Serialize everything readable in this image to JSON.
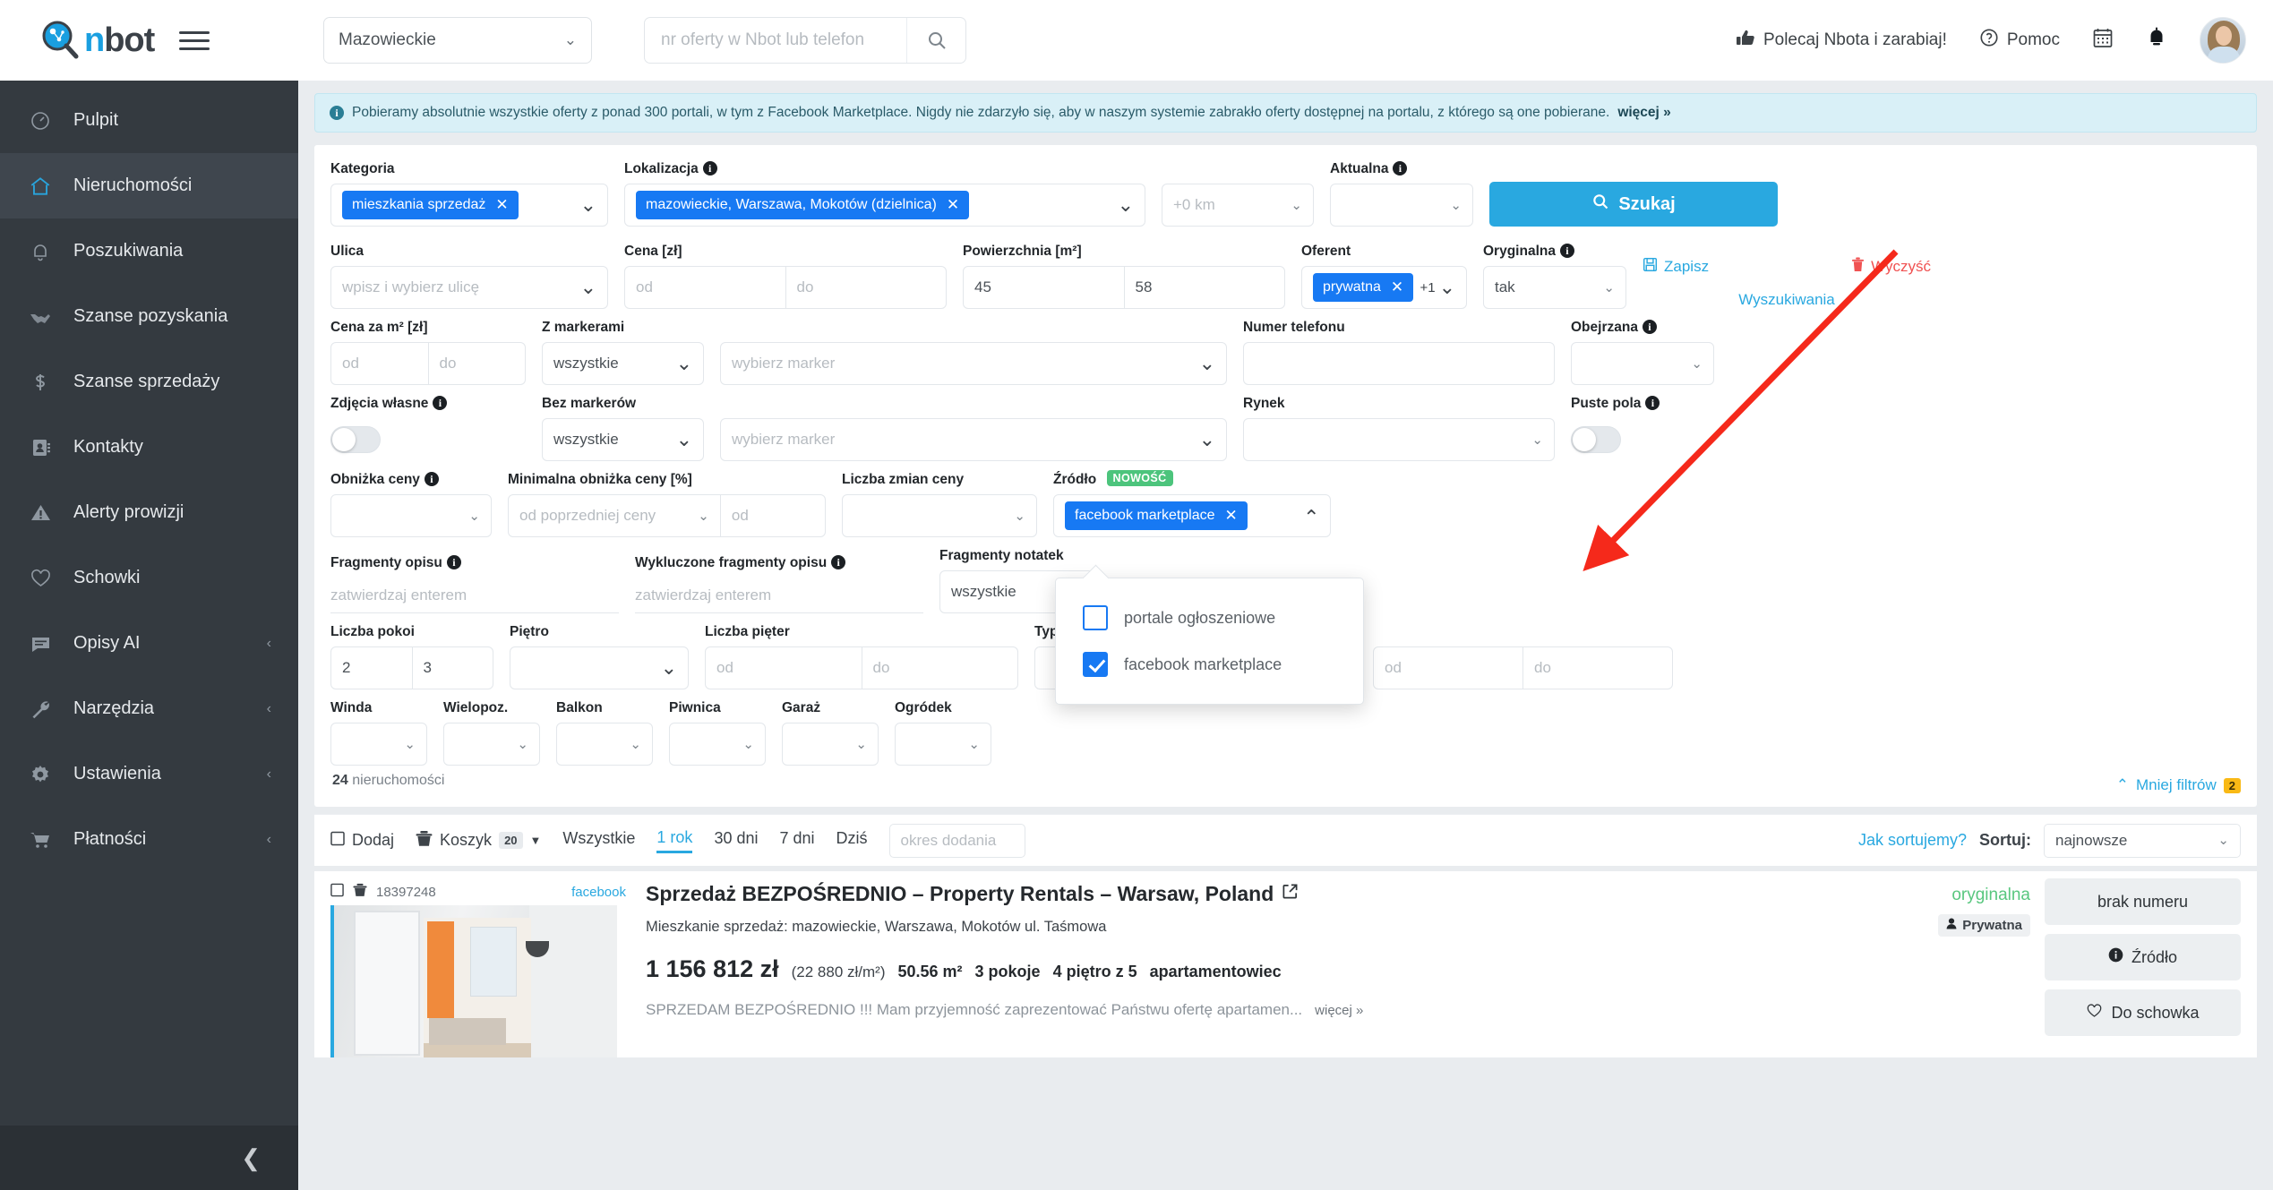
{
  "brand": {
    "name_n": "n",
    "name_bot": "bot"
  },
  "topbar": {
    "region_value": "Mazowieckie",
    "search_placeholder": "nr oferty w Nbot lub telefon",
    "search_value": "",
    "refer_label": "Polecaj Nbota i zarabiaj!",
    "help_label": "Pomoc"
  },
  "sidebar": {
    "items": [
      {
        "label": "Pulpit",
        "icon": "gauge-icon",
        "active": false,
        "caret": false
      },
      {
        "label": "Nieruchomości",
        "icon": "home-icon",
        "active": true,
        "caret": false
      },
      {
        "label": "Poszukiwania",
        "icon": "bell-icon",
        "active": false,
        "caret": false
      },
      {
        "label": "Szanse pozyskania",
        "icon": "handshake-icon",
        "active": false,
        "caret": false
      },
      {
        "label": "Szanse sprzedaży",
        "icon": "dollar-icon",
        "active": false,
        "caret": false
      },
      {
        "label": "Kontakty",
        "icon": "contacts-icon",
        "active": false,
        "caret": false
      },
      {
        "label": "Alerty prowizji",
        "icon": "warning-icon",
        "active": false,
        "caret": false
      },
      {
        "label": "Schowki",
        "icon": "heart-icon",
        "active": false,
        "caret": false
      },
      {
        "label": "Opisy AI",
        "icon": "comment-icon",
        "active": false,
        "caret": true
      },
      {
        "label": "Narzędzia",
        "icon": "wrench-icon",
        "active": false,
        "caret": true
      },
      {
        "label": "Ustawienia",
        "icon": "gear-icon",
        "active": false,
        "caret": true
      },
      {
        "label": "Płatności",
        "icon": "cart-icon",
        "active": false,
        "caret": true
      }
    ]
  },
  "notice": {
    "text": "Pobieramy absolutnie wszystkie oferty z ponad 300 portali, w tym z Facebook Marketplace. Nigdy nie zdarzyło się, aby w naszym systemie zabrakło oferty dostępnej na portalu, z którego są one pobierane.",
    "more": "więcej »"
  },
  "filters": {
    "kategoria_label": "Kategoria",
    "kategoria_tag": "mieszkania sprzedaż",
    "lokalizacja_label": "Lokalizacja",
    "lokalizacja_tag": "mazowieckie, Warszawa, Mokotów (dzielnica)",
    "radius_value": "+0 km",
    "aktualna_label": "Aktualna",
    "aktualna_value": "",
    "search_button": "Szukaj",
    "ulica_label": "Ulica",
    "ulica_placeholder": "wpisz i wybierz ulicę",
    "cena_label": "Cena [zł]",
    "cena_od": "od",
    "cena_do": "do",
    "powierzchnia_label": "Powierzchnia [m²]",
    "powierzchnia_od": "45",
    "powierzchnia_do": "58",
    "oferent_label": "Oferent",
    "oferent_tag": "prywatna",
    "oferent_extra": "+1",
    "oryginalna_label": "Oryginalna",
    "oryginalna_value": "tak",
    "save_label": "Zapisz",
    "clear_label": "Wyczyść",
    "searches_label": "Wyszukiwania",
    "cena_m2_label": "Cena za m² [zł]",
    "cena_m2_od": "od",
    "cena_m2_do": "do",
    "z_markerami_label": "Z markerami",
    "z_markerami_value": "wszystkie",
    "z_markerami_picker": "wybierz marker",
    "numer_tel_label": "Numer telefonu",
    "numer_tel_value": "",
    "obejrzana_label": "Obejrzana",
    "obejrzana_value": "",
    "zdjecia_label": "Zdjęcia własne",
    "bez_markerow_label": "Bez markerów",
    "bez_markerow_value": "wszystkie",
    "bez_markerow_picker": "wybierz marker",
    "rynek_label": "Rynek",
    "rynek_value": "",
    "puste_pola_label": "Puste pola",
    "obnizka_label": "Obniżka ceny",
    "obnizka_value": "",
    "min_obnizka_label": "Minimalna obniżka ceny [%]",
    "min_obnizka_value": "od poprzedniej ceny",
    "min_obnizka_od": "od",
    "liczba_zmian_label": "Liczba zmian ceny",
    "liczba_zmian_value": "",
    "zrodlo_label": "Źródło",
    "zrodlo_badge": "NOWOŚĆ",
    "zrodlo_tag": "facebook marketplace",
    "zrodlo_options": [
      {
        "label": "portale ogłoszeniowe",
        "checked": false
      },
      {
        "label": "facebook marketplace",
        "checked": true
      }
    ],
    "fragmenty_opisu_label": "Fragmenty opisu",
    "fragmenty_opisu_placeholder": "zatwierdzaj enterem",
    "wykluczone_label": "Wykluczone fragmenty opisu",
    "wykluczone_placeholder": "zatwierdzaj enterem",
    "fragmenty_notatek_label": "Fragmenty notatek",
    "fragmenty_notatek_value": "wszystkie",
    "liczba_pokoi_label": "Liczba pokoi",
    "liczba_pokoi_od": "2",
    "liczba_pokoi_do": "3",
    "pietro_label": "Piętro",
    "pietro_value": "",
    "liczba_pieter_label": "Liczba pięter",
    "liczba_pieter_od": "od",
    "liczba_pieter_do": "do",
    "typ_zabudowy_label": "Typ zabudowy",
    "typ_zabudowy_value": "",
    "rok_od": "od",
    "rok_do": "do",
    "winda_label": "Winda",
    "wielopoz_label": "Wielopoz.",
    "balkon_label": "Balkon",
    "piwnica_label": "Piwnica",
    "garaz_label": "Garaż",
    "ogrodek_label": "Ogródek",
    "results_count": "24",
    "results_word": "nieruchomości",
    "less_filters": "Mniej filtrów",
    "less_filters_count": "2"
  },
  "toolbar": {
    "add_label": "Dodaj",
    "basket_label": "Koszyk",
    "basket_count": "20",
    "tabs": [
      {
        "label": "Wszystkie",
        "active": false
      },
      {
        "label": "1 rok",
        "active": true
      },
      {
        "label": "30 dni",
        "active": false
      },
      {
        "label": "7 dni",
        "active": false
      },
      {
        "label": "Dziś",
        "active": false
      }
    ],
    "period_placeholder": "okres dodania",
    "sort_help": "Jak sortujemy?",
    "sort_label": "Sortuj:",
    "sort_value": "najnowsze"
  },
  "listing": {
    "id": "18397248",
    "source": "facebook",
    "title": "Sprzedaż BEZPOŚREDNIO – Property Rentals – Warsaw, Poland",
    "subtitle": "Mieszkanie sprzedaż: mazowieckie, Warszawa, Mokotów ul. Taśmowa",
    "price": "1 156 812 zł",
    "price_per_m2": "(22 880 zł/m²)",
    "area": "50.56 m²",
    "rooms": "3 pokoje",
    "floor": "4 piętro z 5",
    "building_type": "apartamentowiec",
    "description": "SPRZEDAM BEZPOŚREDNIO !!! Mam przyjemność zaprezentować Państwu ofertę apartamen...",
    "description_more": "więcej »",
    "flag_original": "oryginalna",
    "flag_private": "Prywatna",
    "actions": [
      {
        "label": "brak numeru",
        "icon": ""
      },
      {
        "label": "Źródło",
        "icon": "info-icon"
      },
      {
        "label": "Do schowka",
        "icon": "heart-icon"
      }
    ]
  },
  "colors": {
    "accent": "#29a8e0",
    "tag_blue": "#1779f3",
    "danger": "#f05252",
    "new_green": "#4cc47c",
    "arrow_red": "#f5291b",
    "sidebar_bg": "#343a40"
  }
}
